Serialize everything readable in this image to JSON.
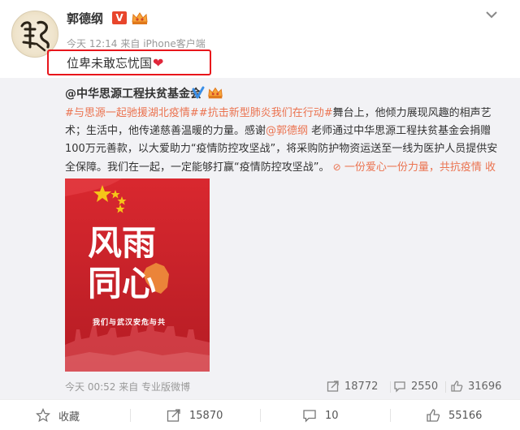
{
  "post": {
    "author": "郭德纲",
    "verified_badge": "V",
    "time": "今天 12:14",
    "source": "来自 iPhone客户端",
    "text": "位卑未敢忘忧国",
    "heart": "❤"
  },
  "repost": {
    "author": "@中华思源工程扶贫基金会",
    "tag1": "#与思源一起驰援湖北疫情#",
    "tag2": "#抗击新型肺炎我们在行动#",
    "body1": "舞台上，他倾力展现风趣的相声艺术；生活中，他传递慈善温暖的力量。感谢",
    "mention": "@郭德纲",
    "body2": " 老师通过中华思源工程扶贫基金会捐赠100万元善款，以大爱助力“疫情防控攻坚战”，将采购防护物资运送至一线为医护人员提供安全保障。我们在一起，一定能够打赢“疫情防控攻坚战”。",
    "link_text": "一份爱心一份力量，共抗疫情",
    "collapse": "收起全文",
    "poster": {
      "line1": "风雨",
      "line2": "同心",
      "subtitle": "我们与武汉安危与共"
    },
    "time": "今天 00:52",
    "source": "来自 专业版微博",
    "share_count": "18772",
    "comment_count": "2550",
    "like_count": "31696"
  },
  "actions": {
    "favorite": "收藏",
    "share": "15870",
    "comment": "10",
    "like": "55166"
  },
  "colors": {
    "accent": "#eb7350",
    "highlight_box": "#e8151b",
    "poster_red": "#c8202a"
  }
}
